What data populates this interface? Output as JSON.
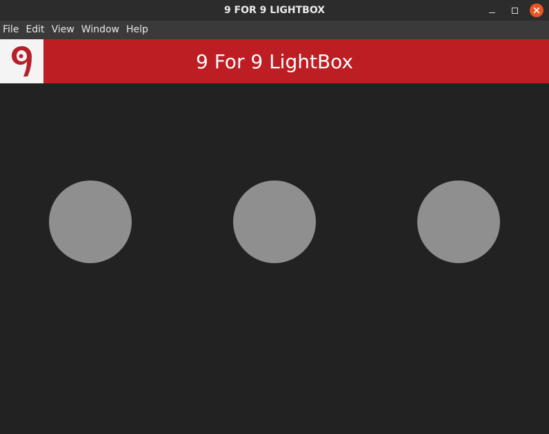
{
  "window": {
    "title": "9 FOR 9 LIGHTBOX",
    "controls": {
      "minimize_icon": "minimize-icon",
      "maximize_icon": "maximize-icon",
      "close_icon": "close-icon",
      "close_color": "#e95420"
    }
  },
  "menubar": {
    "items": [
      {
        "label": "File"
      },
      {
        "label": "Edit"
      },
      {
        "label": "View"
      },
      {
        "label": "Window"
      },
      {
        "label": "Help"
      }
    ]
  },
  "header": {
    "title": "9 For 9 LightBox",
    "background_color": "#bd1e24",
    "logo": {
      "icon": "nine-logo-icon",
      "color": "#b5202a",
      "glyph": "9"
    }
  },
  "lights": [
    {
      "color": "#8f8f8f"
    },
    {
      "color": "#8f8f8f"
    },
    {
      "color": "#8f8f8f"
    }
  ]
}
